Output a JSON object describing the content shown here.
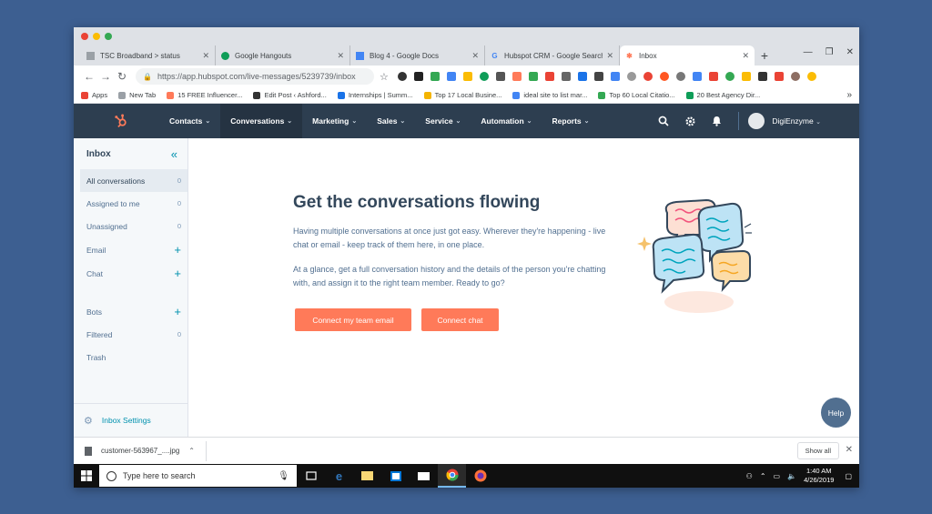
{
  "browser": {
    "tabs": [
      {
        "label": "TSC Broadband > status",
        "icon": "page-icon",
        "color": "#9aa0a6"
      },
      {
        "label": "Google Hangouts",
        "icon": "hangouts-icon",
        "color": "#0f9d58"
      },
      {
        "label": "Blog 4 - Google Docs",
        "icon": "docs-icon",
        "color": "#4285f4"
      },
      {
        "label": "Hubspot CRM - Google Search",
        "icon": "google-icon",
        "color": "#4285f4"
      },
      {
        "label": "Inbox",
        "icon": "hubspot-icon",
        "color": "#ff7a59"
      }
    ],
    "url": "https://app.hubspot.com/live-messages/5239739/inbox",
    "bookmarks": [
      {
        "label": "Apps",
        "color": "#ea4335"
      },
      {
        "label": "New Tab",
        "color": "#9aa0a6"
      },
      {
        "label": "15 FREE Influencer...",
        "color": "#ff7a59"
      },
      {
        "label": "Edit Post ‹ Ashford...",
        "color": "#333333"
      },
      {
        "label": "Internships | Summ...",
        "color": "#1a73e8"
      },
      {
        "label": "Top 17 Local Busine...",
        "color": "#f4b400"
      },
      {
        "label": "ideal site to list mar...",
        "color": "#4285f4"
      },
      {
        "label": "Top 60 Local Citatio...",
        "color": "#34a853"
      },
      {
        "label": "20 Best Agency Dir...",
        "color": "#0f9d58"
      }
    ]
  },
  "hubspot": {
    "nav": [
      {
        "label": "Contacts",
        "active": false
      },
      {
        "label": "Conversations",
        "active": true
      },
      {
        "label": "Marketing",
        "active": false
      },
      {
        "label": "Sales",
        "active": false
      },
      {
        "label": "Service",
        "active": false
      },
      {
        "label": "Automation",
        "active": false
      },
      {
        "label": "Reports",
        "active": false
      }
    ],
    "account": "DigiEnzyme"
  },
  "sidebar": {
    "title": "Inbox",
    "items": [
      {
        "label": "All conversations",
        "count": "0"
      },
      {
        "label": "Assigned to me",
        "count": "0"
      },
      {
        "label": "Unassigned",
        "count": "0"
      },
      {
        "label": "Email",
        "plus": "+"
      },
      {
        "label": "Chat",
        "plus": "+"
      },
      {
        "label": "Bots",
        "plus": "+"
      },
      {
        "label": "Filtered",
        "count": "0"
      },
      {
        "label": "Trash"
      }
    ],
    "settings": "Inbox Settings"
  },
  "main": {
    "headline": "Get the conversations flowing",
    "para1": "Having multiple conversations at once just got easy. Wherever they're happening - live chat or email - keep track of them here, in one place.",
    "para2": "At a glance, get a full conversation history and the details of the person you're chatting with, and assign it to the right team member. Ready to go?",
    "btn_email": "Connect my team email",
    "btn_chat": "Connect chat",
    "help": "Help"
  },
  "download": {
    "file": "customer-563967_....jpg",
    "show_all": "Show all"
  },
  "taskbar": {
    "search_placeholder": "Type here to search",
    "time": "1:40 AM",
    "date": "4/26/2019"
  },
  "colors": {
    "accent": "#ff7a59",
    "nav_bg": "#2d3e50",
    "link": "#0091ae",
    "desktop": "#3d5f91"
  }
}
